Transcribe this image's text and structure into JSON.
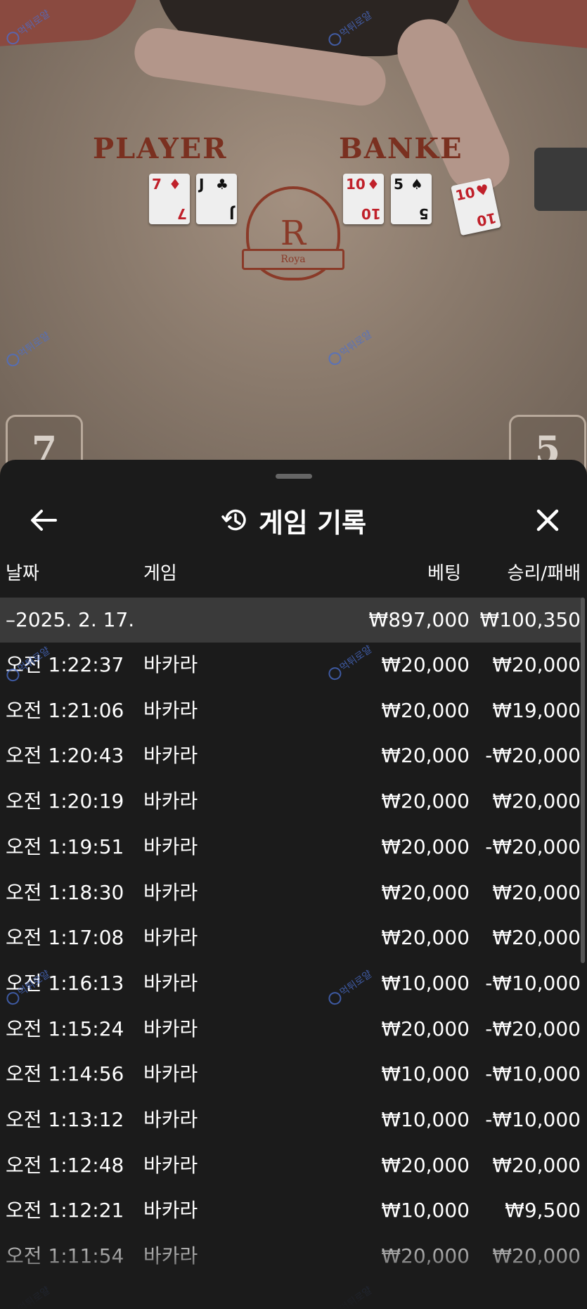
{
  "table": {
    "player_label": "PLAYER",
    "banker_label": "BANKE",
    "crest_letter": "R",
    "crest_banner": "Roya",
    "player_score": "7",
    "banker_score": "5",
    "player_cards": [
      {
        "rank": "7",
        "suit": "♦",
        "color": "red"
      },
      {
        "rank": "J",
        "suit": "♣",
        "color": "black"
      }
    ],
    "banker_cards": [
      {
        "rank": "10",
        "suit": "♦",
        "color": "red"
      },
      {
        "rank": "5",
        "suit": "♠",
        "color": "black"
      },
      {
        "rank": "10",
        "suit": "♥",
        "color": "red"
      }
    ],
    "watermark": "먹튀로얄"
  },
  "sheet": {
    "title": "게임 기록",
    "back_icon": "arrow-left-icon",
    "history_icon": "history-icon",
    "close_icon": "close-icon",
    "columns": {
      "date": "날짜",
      "game": "게임",
      "bet": "베팅",
      "result": "승리/패배"
    },
    "date_group": {
      "label": "–2025. 2. 17.",
      "bet_total": "₩897,000",
      "result_total": "₩100,350"
    },
    "rows": [
      {
        "time": "오전 1:22:37",
        "game": "바카라",
        "bet": "₩20,000",
        "result": "₩20,000"
      },
      {
        "time": "오전 1:21:06",
        "game": "바카라",
        "bet": "₩20,000",
        "result": "₩19,000"
      },
      {
        "time": "오전 1:20:43",
        "game": "바카라",
        "bet": "₩20,000",
        "result": "-₩20,000"
      },
      {
        "time": "오전 1:20:19",
        "game": "바카라",
        "bet": "₩20,000",
        "result": "₩20,000"
      },
      {
        "time": "오전 1:19:51",
        "game": "바카라",
        "bet": "₩20,000",
        "result": "-₩20,000"
      },
      {
        "time": "오전 1:18:30",
        "game": "바카라",
        "bet": "₩20,000",
        "result": "₩20,000"
      },
      {
        "time": "오전 1:17:08",
        "game": "바카라",
        "bet": "₩20,000",
        "result": "₩20,000"
      },
      {
        "time": "오전 1:16:13",
        "game": "바카라",
        "bet": "₩10,000",
        "result": "-₩10,000"
      },
      {
        "time": "오전 1:15:24",
        "game": "바카라",
        "bet": "₩20,000",
        "result": "-₩20,000"
      },
      {
        "time": "오전 1:14:56",
        "game": "바카라",
        "bet": "₩10,000",
        "result": "-₩10,000"
      },
      {
        "time": "오전 1:13:12",
        "game": "바카라",
        "bet": "₩10,000",
        "result": "-₩10,000"
      },
      {
        "time": "오전 1:12:48",
        "game": "바카라",
        "bet": "₩20,000",
        "result": "₩20,000"
      },
      {
        "time": "오전 1:12:21",
        "game": "바카라",
        "bet": "₩10,000",
        "result": "₩9,500"
      },
      {
        "time": "오전 1:11:54",
        "game": "바카라",
        "bet": "₩20,000",
        "result": "₩20,000"
      }
    ]
  }
}
